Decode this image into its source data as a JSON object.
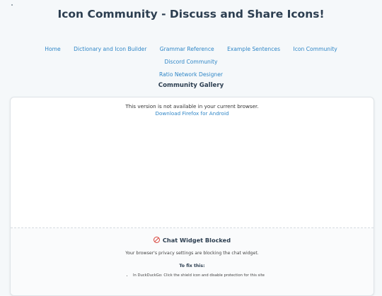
{
  "header": {
    "title": "Icon Community - Discuss and Share Icons!"
  },
  "nav": {
    "items": [
      {
        "label": "Home"
      },
      {
        "label": "Dictionary and Icon Builder"
      },
      {
        "label": "Grammar Reference"
      },
      {
        "label": "Example Sentences"
      },
      {
        "label": "Icon Community"
      },
      {
        "label": "Discord Community"
      },
      {
        "label": "Ratio Network Designer"
      }
    ]
  },
  "gallery": {
    "heading": "Community Gallery",
    "unavailable_text": "This version is not available in your current browser.",
    "download_link": "Download Firefox for Android"
  },
  "chat_widget": {
    "icon": "ban-icon",
    "title": "Chat Widget Blocked",
    "message": "Your browser's privacy settings are blocking the chat widget.",
    "fix_heading": "To fix this:",
    "fix_steps": [
      "In DuckDuckGo: Click the shield icon and disable protection for this site"
    ]
  },
  "colors": {
    "background": "#f5f8fa",
    "link": "#2f86c7",
    "heading": "#2c3e50",
    "blocked_icon": "#d9453c"
  }
}
